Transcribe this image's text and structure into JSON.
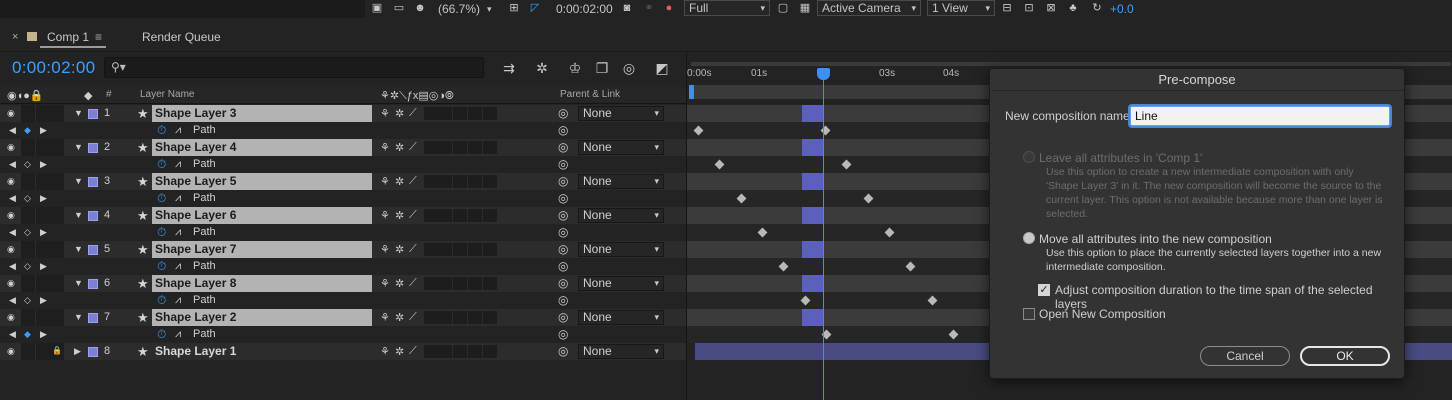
{
  "viewer_bar": {
    "zoom": "(66.7%)",
    "timecode": "0:00:02:00",
    "resolution": "Full",
    "camera": "Active Camera",
    "views": "1 View",
    "exposure": "+0.0"
  },
  "tabs": [
    {
      "label": "Comp 1",
      "active": true
    },
    {
      "label": "Render Queue",
      "active": false
    }
  ],
  "comp": {
    "current_time": "0:00:02:00",
    "search_placeholder": ""
  },
  "columns": {
    "hash": "#",
    "layer_name": "Layer Name",
    "parent": "Parent & Link"
  },
  "layers": [
    {
      "num": "1",
      "name": "Shape Layer 3",
      "parent": "None",
      "property": "Path",
      "selected": true
    },
    {
      "num": "2",
      "name": "Shape Layer 4",
      "parent": "None",
      "property": "Path",
      "selected": true
    },
    {
      "num": "3",
      "name": "Shape Layer 5",
      "parent": "None",
      "property": "Path",
      "selected": true
    },
    {
      "num": "4",
      "name": "Shape Layer 6",
      "parent": "None",
      "property": "Path",
      "selected": true
    },
    {
      "num": "5",
      "name": "Shape Layer 7",
      "parent": "None",
      "property": "Path",
      "selected": true
    },
    {
      "num": "6",
      "name": "Shape Layer 8",
      "parent": "None",
      "property": "Path",
      "selected": true
    },
    {
      "num": "7",
      "name": "Shape Layer 2",
      "parent": "None",
      "property": "Path",
      "selected": true
    },
    {
      "num": "8",
      "name": "Shape Layer 1",
      "parent": "None",
      "property": null,
      "selected": false
    }
  ],
  "ruler": [
    "0:00s",
    "01s",
    "03s",
    "04s"
  ],
  "dialog": {
    "title": "Pre-compose",
    "name_label": "New composition name:",
    "name_value": "Line",
    "option1_title": "Leave all attributes in 'Comp 1'",
    "option1_desc": "Use this option to create a new intermediate composition with only 'Shape Layer 3' in it. The new composition will become the source to the current layer. This option is not available because more than one layer is selected.",
    "option2_title": "Move all attributes into the new composition",
    "option2_desc": "Use this option to place the currently selected layers together into a new intermediate composition.",
    "adjust_label": "Adjust composition duration to the time span of the selected layers",
    "adjust_checked": true,
    "open_label": "Open New Composition",
    "open_checked": false,
    "cancel_label": "Cancel",
    "ok_label": "OK"
  },
  "colors": {
    "accent_blue": "#3aa0ff",
    "label_purple": "#7b7fd6",
    "layer_bar_selected": "#5b60bf"
  }
}
